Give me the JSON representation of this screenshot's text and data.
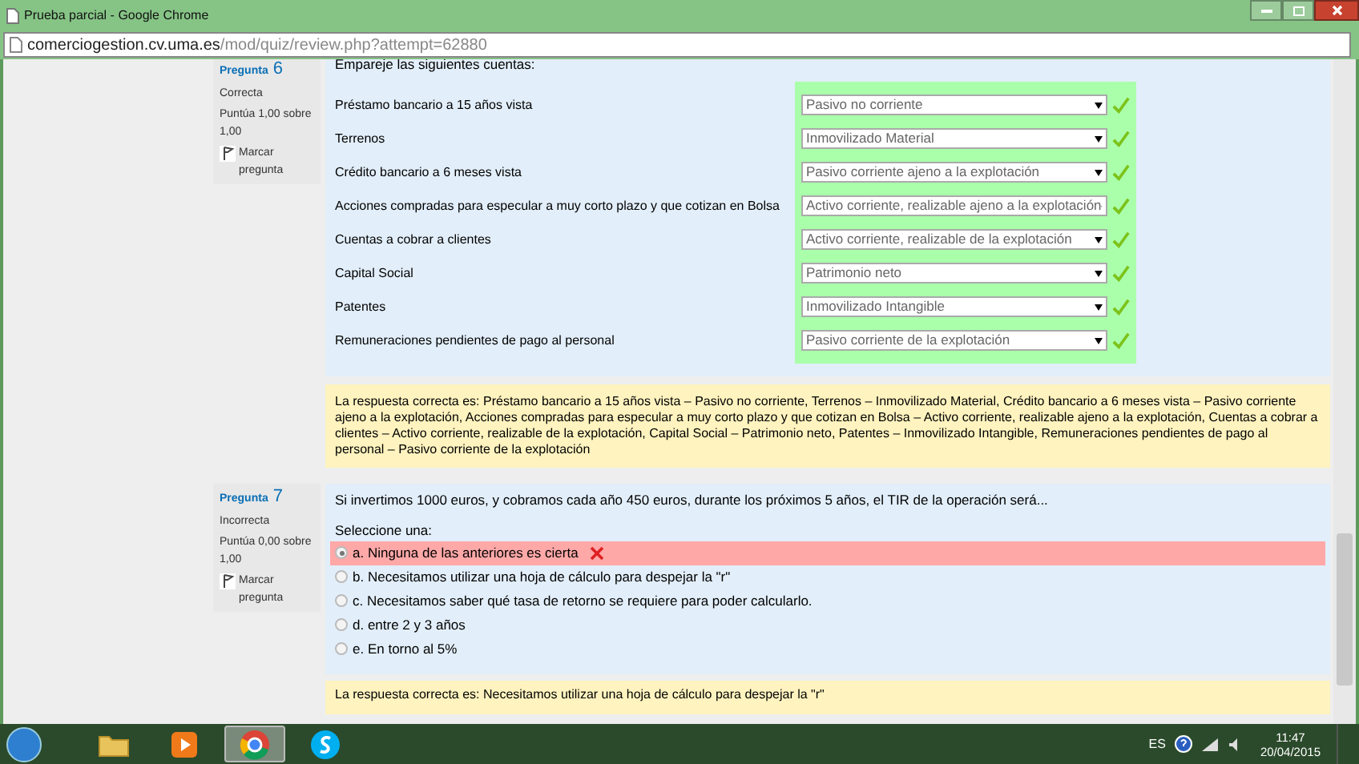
{
  "window": {
    "title": "Prueba parcial - Google Chrome"
  },
  "address_bar": {
    "host": "comerciogestion.cv.uma.es",
    "path": "/mod/quiz/review.php?attempt=62880"
  },
  "questions": [
    {
      "kind": "matching",
      "label": "Pregunta",
      "number": "6",
      "status": "Correcta",
      "grade": "Puntúa 1,00 sobre 1,00",
      "flag": "Marcar pregunta",
      "prompt": "Empareje las siguientes cuentas:",
      "pairs": [
        {
          "term": "Préstamo bancario a 15 años vista",
          "answer": "Pasivo no corriente",
          "correct": true
        },
        {
          "term": "Terrenos",
          "answer": "Inmovilizado Material",
          "correct": true
        },
        {
          "term": "Crédito bancario a 6 meses vista",
          "answer": "Pasivo corriente ajeno a la explotación",
          "correct": true
        },
        {
          "term": "Acciones compradas para especular a muy corto plazo y que cotizan en Bolsa",
          "answer": "Activo corriente, realizable ajeno a la explotación",
          "correct": true
        },
        {
          "term": "Cuentas a cobrar a clientes",
          "answer": "Activo corriente, realizable de la explotación",
          "correct": true
        },
        {
          "term": "Capital Social",
          "answer": "Patrimonio neto",
          "correct": true
        },
        {
          "term": "Patentes",
          "answer": "Inmovilizado Intangible",
          "correct": true
        },
        {
          "term": "Remuneraciones pendientes de pago al personal",
          "answer": "Pasivo corriente de la explotación",
          "correct": true
        }
      ],
      "feedback": "La respuesta correcta es: Préstamo bancario a 15 años vista – Pasivo no corriente, Terrenos – Inmovilizado Material, Crédito bancario a 6 meses vista – Pasivo corriente ajeno a la explotación, Acciones compradas para especular a muy corto plazo y que cotizan en Bolsa – Activo corriente, realizable ajeno a la explotación, Cuentas a cobrar a clientes – Activo corriente, realizable de la explotación, Capital Social – Patrimonio neto, Patentes – Inmovilizado Intangible, Remuneraciones pendientes de pago al personal – Pasivo corriente de la explotación"
    },
    {
      "kind": "multichoice",
      "label": "Pregunta",
      "number": "7",
      "status": "Incorrecta",
      "grade": "Puntúa 0,00 sobre 1,00",
      "flag": "Marcar pregunta",
      "prompt": "Si invertimos 1000 euros, y cobramos cada año 450 euros, durante los próximos 5 años, el TIR de la operación será...",
      "instruction": "Seleccione una:",
      "options": [
        {
          "text": "a. Ninguna de las anteriores es cierta",
          "selected": true,
          "correct": false
        },
        {
          "text": "b. Necesitamos utilizar una hoja de cálculo para despejar la \"r\"",
          "selected": false
        },
        {
          "text": "c. Necesitamos saber qué tasa de retorno se requiere para poder calcularlo.",
          "selected": false
        },
        {
          "text": "d. entre 2 y 3 años",
          "selected": false
        },
        {
          "text": "e. En torno al 5%",
          "selected": false
        }
      ],
      "feedback": "La respuesta correcta es: Necesitamos utilizar una hoja de cálculo para despejar la \"r\""
    }
  ],
  "taskbar": {
    "apps": [
      {
        "kind": "folder",
        "selected": false
      },
      {
        "kind": "media",
        "selected": false
      },
      {
        "kind": "browser",
        "selected": true
      },
      {
        "kind": "chat",
        "selected": false
      }
    ],
    "language": "ES",
    "time": "11:47",
    "date": "20/04/2015"
  }
}
